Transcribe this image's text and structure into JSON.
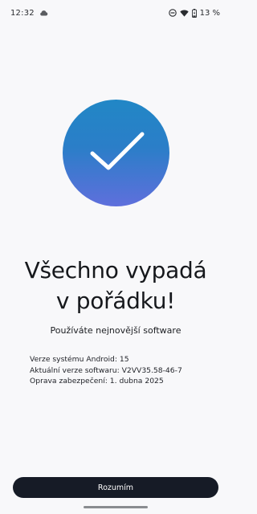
{
  "status_bar": {
    "time": "12:32",
    "left_icons": [
      "cloud-icon"
    ],
    "right_icons": [
      "do-not-disturb-icon",
      "wifi-icon",
      "battery-icon"
    ],
    "battery_percent": "13 %"
  },
  "hero": {
    "icon": "checkmark-icon",
    "gradient_top": "#2187c6",
    "gradient_bottom": "#5f6fdc"
  },
  "headline": {
    "line1": "Všechno vypadá",
    "line2": "v pořádku!"
  },
  "subtitle": "Používáte nejnovější software",
  "info": {
    "android_version": "Verze systému Android: 15",
    "software_version": "Aktuální verze softwaru: V2VV35.58-46-7",
    "security_patch": "Oprava zabezpečení: 1. dubna 2025"
  },
  "button": {
    "label": "Rozumím"
  }
}
